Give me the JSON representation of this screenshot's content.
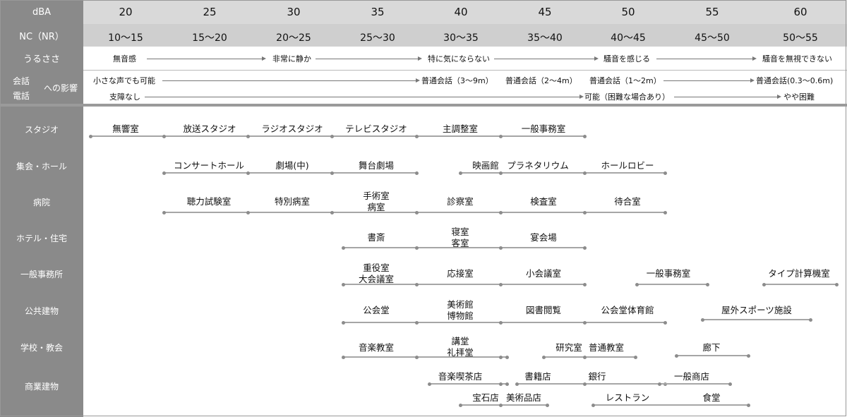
{
  "header": {
    "dba_label": "dBA",
    "nc_label": "NC（NR）",
    "loud_label": "うるささ",
    "talk_label_1": "会話",
    "talk_label_2": "電話",
    "talk_label_3": "への影響",
    "dba_values": [
      "20",
      "25",
      "30",
      "35",
      "40",
      "45",
      "50",
      "55",
      "60"
    ],
    "nc_values": [
      "10～15",
      "15～20",
      "20～25",
      "25～30",
      "30～35",
      "35～40",
      "40～45",
      "45～50",
      "50～55"
    ]
  },
  "loudness": [
    {
      "text": "無音感"
    },
    {
      "text": "非常に静か"
    },
    {
      "text": "特に気にならない"
    },
    {
      "text": "騒音を感じる"
    },
    {
      "text": "騒音を無視できない"
    }
  ],
  "talk_row1": [
    {
      "text": "小さな声でも可能"
    },
    {
      "text": "普通会話（3～9m）"
    },
    {
      "text": "普通会話（2～4m）"
    },
    {
      "text": "普通会話（1～2m）"
    },
    {
      "text": "普通会話(0.3～0.6m)"
    }
  ],
  "talk_row2": [
    {
      "text": "支障なし"
    },
    {
      "text": "可能（困難な場合あり）"
    },
    {
      "text": "やや困難"
    }
  ],
  "categories": [
    {
      "label": "スタジオ",
      "rooms": [
        "無響室",
        "放送スタジオ",
        "ラジオスタジオ",
        "テレビスタジオ",
        "主調整室",
        "一般事務室"
      ]
    },
    {
      "label": "集会・ホール",
      "rooms": [
        "コンサートホール",
        "劇場(中)",
        "舞台劇場",
        "映画館",
        "プラネタリウム",
        "ホールロビー"
      ]
    },
    {
      "label": "病院",
      "rooms": [
        "聴力試験室",
        "特別病室",
        "手術室",
        "病室",
        "診察室",
        "検査室",
        "待合室"
      ]
    },
    {
      "label": "ホテル・住宅",
      "rooms": [
        "書斎",
        "寝室",
        "客室",
        "宴会場"
      ]
    },
    {
      "label": "一般事務所",
      "rooms": [
        "重役室",
        "大会議室",
        "応接室",
        "小会議室",
        "一般事務室",
        "タイプ計算機室"
      ]
    },
    {
      "label": "公共建物",
      "rooms": [
        "公会堂",
        "美術館",
        "博物館",
        "図書閲覧",
        "公会堂体育館",
        "屋外スポーツ施設"
      ]
    },
    {
      "label": "学校・教会",
      "rooms": [
        "音楽教室",
        "講堂",
        "礼拝堂",
        "研究室",
        "普通教室",
        "廊下"
      ]
    },
    {
      "label": "商業建物",
      "rooms": [
        "音楽喫茶店",
        "書籍店",
        "銀行",
        "一般商店",
        "宝石店",
        "美術品店",
        "レストラン",
        "食堂"
      ]
    }
  ],
  "colors": {
    "header_dark": "#8a8a8a",
    "header_light": "#d9d9d9",
    "category_bg": "#8a8a8a",
    "bar": "#a6a6a6"
  }
}
